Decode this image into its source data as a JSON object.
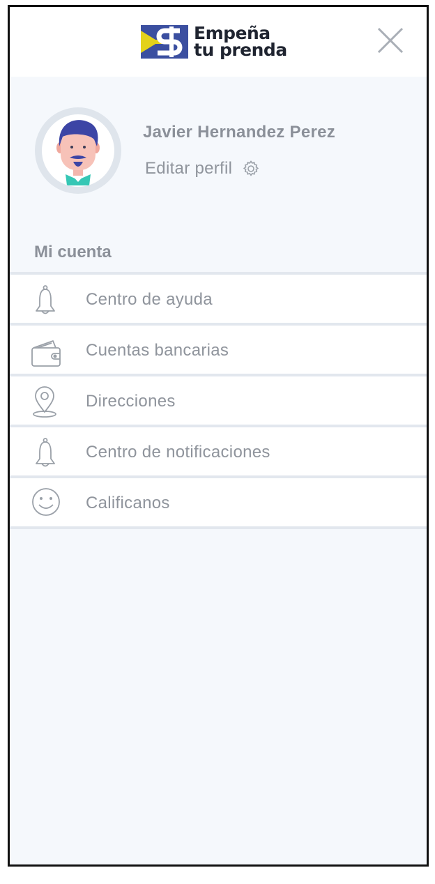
{
  "header": {
    "logo_line1": "Empeña",
    "logo_line2": "tu prenda",
    "close_icon": "close-icon"
  },
  "profile": {
    "name": "Javier Hernandez Perez",
    "edit_label": "Editar perfil",
    "edit_icon": "gear-icon"
  },
  "account": {
    "section_title": "Mi cuenta",
    "items": [
      {
        "label": "Centro de ayuda",
        "icon": "bell-icon"
      },
      {
        "label": "Cuentas bancarias",
        "icon": "wallet-icon"
      },
      {
        "label": "Direcciones",
        "icon": "location-pin-icon"
      },
      {
        "label": "Centro de notificaciones",
        "icon": "bell-icon"
      },
      {
        "label": "Calificanos",
        "icon": "smiley-icon"
      }
    ]
  },
  "colors": {
    "brand_blue": "#3b4fa0",
    "brand_yellow": "#e3d21b",
    "text_gray": "#8f949c",
    "panel_background": "#f5f8fc"
  }
}
